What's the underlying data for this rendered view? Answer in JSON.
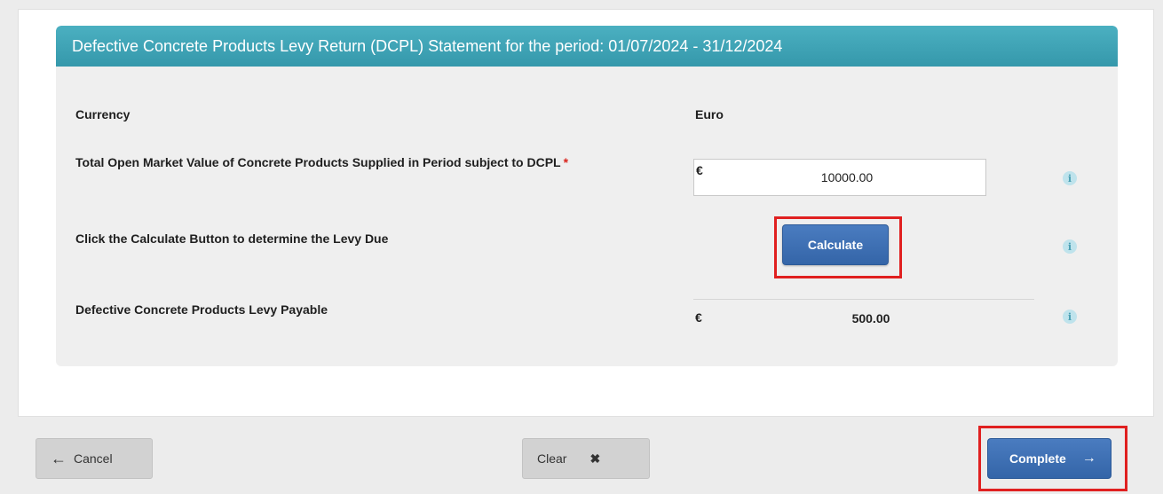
{
  "panel": {
    "title": "Defective Concrete Products Levy Return (DCPL) Statement for the period: 01/07/2024 - 31/12/2024"
  },
  "rows": {
    "currency": {
      "label": "Currency",
      "value": "Euro"
    },
    "open_market_value": {
      "label": "Total Open Market Value of Concrete Products Supplied in Period subject to DCPL",
      "required_mark": "*",
      "currency_symbol": "€",
      "value": "10000.00"
    },
    "calculate": {
      "label": "Click the Calculate Button to determine the Levy Due",
      "button_label": "Calculate"
    },
    "levy_payable": {
      "label": "Defective Concrete Products Levy Payable",
      "currency_symbol": "€",
      "value": "500.00"
    },
    "info_glyph": "i"
  },
  "footer": {
    "cancel_label": "Cancel",
    "cancel_icon": "←",
    "clear_label": "Clear",
    "clear_icon": "✖",
    "complete_label": "Complete",
    "complete_icon": "→"
  },
  "colors": {
    "header_teal": "#3fa3b5",
    "button_blue": "#3465a8",
    "highlight_red": "#e02020",
    "required_red": "#d9241c"
  },
  "icons": [
    "info-icon",
    "arrow-left-icon",
    "close-icon",
    "arrow-right-icon"
  ]
}
